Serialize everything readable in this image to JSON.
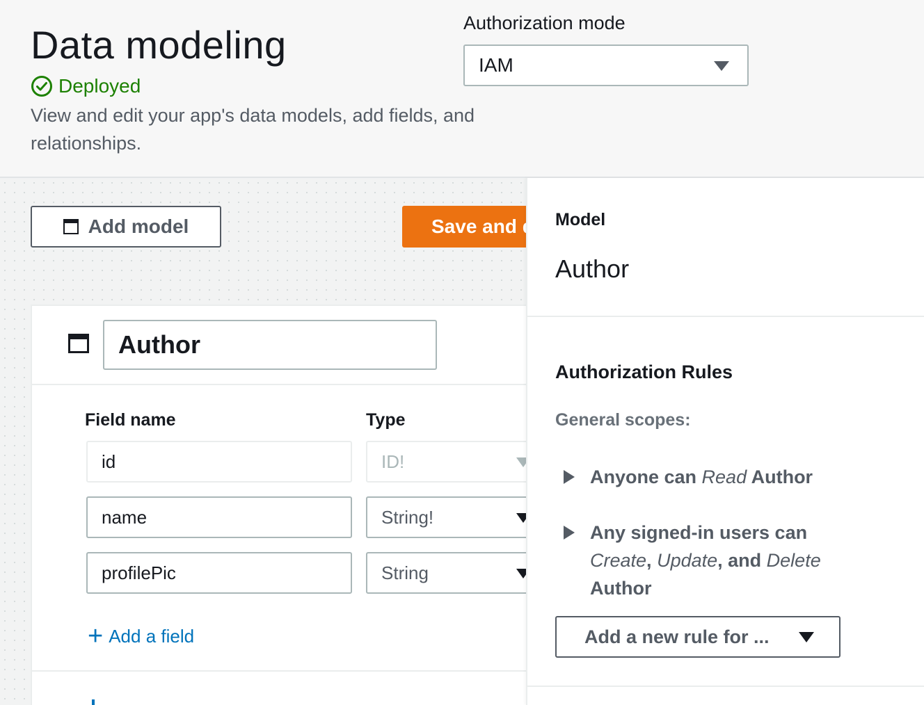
{
  "header": {
    "title": "Data modeling",
    "status": "Deployed",
    "description": "View and edit your app's data models, add fields, and relationships.",
    "auth_mode_label": "Authorization mode",
    "auth_mode_value": "IAM"
  },
  "toolbar": {
    "add_model_label": "Add model",
    "save_label": "Save and deploy"
  },
  "model_card": {
    "name": "Author",
    "field_name_header": "Field name",
    "type_header": "Type",
    "fields": [
      {
        "name": "id",
        "type": "ID!"
      },
      {
        "name": "name",
        "type": "String!"
      },
      {
        "name": "profilePic",
        "type": "String"
      }
    ],
    "add_field_label": "Add a field"
  },
  "panel": {
    "section_label": "Model",
    "model_name": "Author",
    "rules_title": "Authorization Rules",
    "scopes_label": "General scopes:",
    "rule1": {
      "pre": "Anyone can ",
      "action": "Read",
      "post": " Author"
    },
    "rule2": {
      "pre": "Any signed-in users can ",
      "a1": "Create",
      "sep1": ",",
      "a2": "Update",
      "sep2": ", and ",
      "a3": "Delete",
      "post": " Author"
    },
    "new_rule_label": "Add a new rule for ..."
  },
  "colors": {
    "accent": "#ec7211",
    "link": "#0073bb",
    "success": "#1d8102"
  }
}
